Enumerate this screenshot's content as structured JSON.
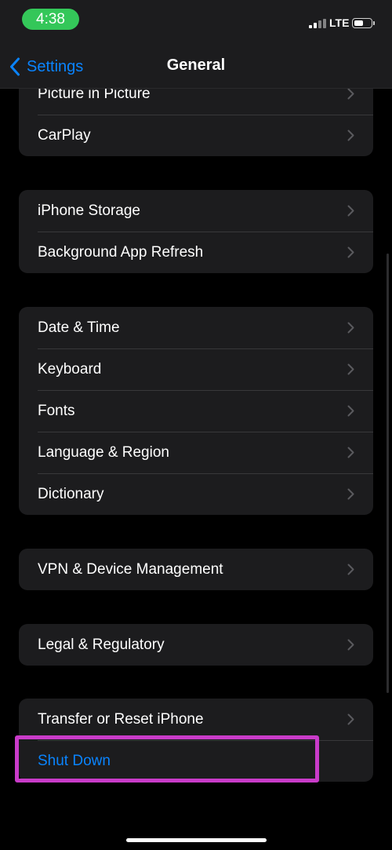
{
  "status_bar": {
    "time": "4:38",
    "network": "LTE",
    "time_pill_color": "#34c759",
    "battery_level": 0.55
  },
  "nav": {
    "back_label": "Settings",
    "title": "General",
    "accent_color": "#0a84ff"
  },
  "groups": [
    {
      "items": [
        {
          "label": "Picture in Picture",
          "chevron": true
        },
        {
          "label": "CarPlay",
          "chevron": true
        }
      ]
    },
    {
      "items": [
        {
          "label": "iPhone Storage",
          "chevron": true
        },
        {
          "label": "Background App Refresh",
          "chevron": true
        }
      ]
    },
    {
      "items": [
        {
          "label": "Date & Time",
          "chevron": true
        },
        {
          "label": "Keyboard",
          "chevron": true
        },
        {
          "label": "Fonts",
          "chevron": true
        },
        {
          "label": "Language & Region",
          "chevron": true
        },
        {
          "label": "Dictionary",
          "chevron": true
        }
      ]
    },
    {
      "items": [
        {
          "label": "VPN & Device Management",
          "chevron": true
        }
      ]
    },
    {
      "items": [
        {
          "label": "Legal & Regulatory",
          "chevron": true
        }
      ]
    },
    {
      "items": [
        {
          "label": "Transfer or Reset iPhone",
          "chevron": true
        },
        {
          "label": "Shut Down",
          "chevron": false,
          "style": "blue"
        }
      ]
    }
  ],
  "highlight_color": "#c93bc9"
}
